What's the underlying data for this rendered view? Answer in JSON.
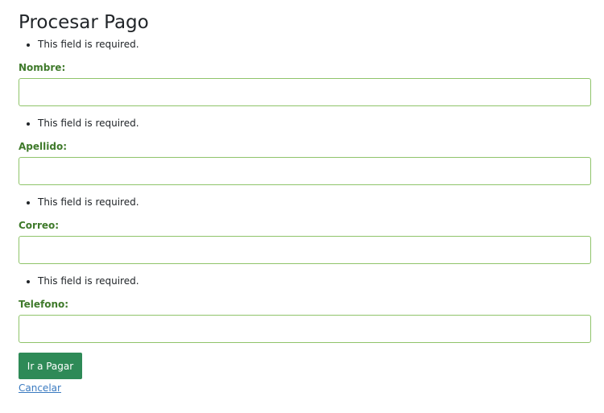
{
  "page": {
    "title": "Procesar Pago"
  },
  "errors": {
    "required": "This field is required."
  },
  "fields": [
    {
      "label": "Nombre:",
      "value": ""
    },
    {
      "label": "Apellido:",
      "value": ""
    },
    {
      "label": "Correo:",
      "value": ""
    },
    {
      "label": "Telefono:",
      "value": ""
    }
  ],
  "actions": {
    "submit_label": "Ir a Pagar",
    "cancel_label": "Cancelar"
  },
  "colors": {
    "label": "#3f7a2b",
    "input_border": "#8fc46a",
    "button_bg": "#2e8a57",
    "link": "#3a7ac0"
  }
}
